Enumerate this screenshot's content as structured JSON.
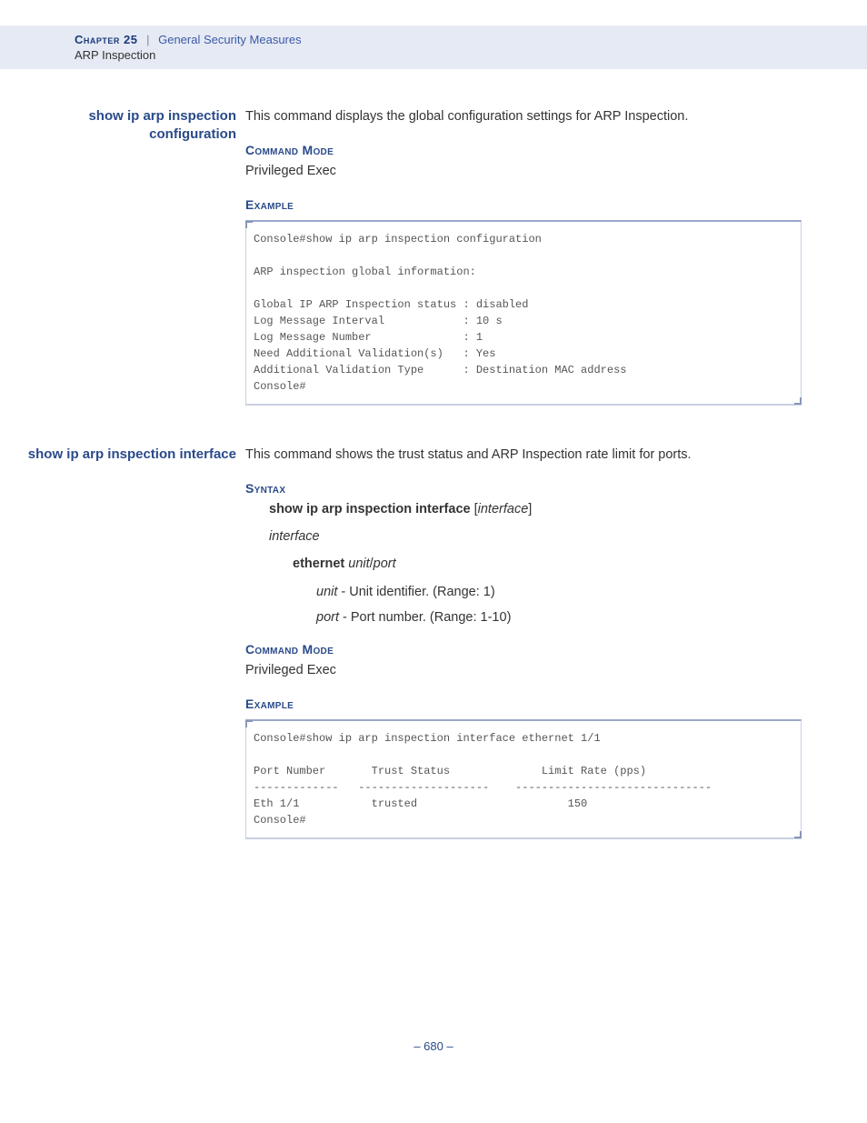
{
  "header": {
    "chapter_label": "Chapter 25",
    "separator": "|",
    "chapter_title": "General Security Measures",
    "subtitle": "ARP Inspection"
  },
  "sections": [
    {
      "margin_title": "show ip arp inspection configuration",
      "description": "This command displays the global configuration settings for ARP Inspection.",
      "command_mode_head": "Command Mode",
      "command_mode": "Privileged Exec",
      "example_head": "Example",
      "example": "Console#show ip arp inspection configuration\n\nARP inspection global information:\n\nGlobal IP ARP Inspection status : disabled\nLog Message Interval            : 10 s\nLog Message Number              : 1\nNeed Additional Validation(s)   : Yes\nAdditional Validation Type      : Destination MAC address\nConsole#"
    },
    {
      "margin_title": "show ip arp inspection interface",
      "description": "This command shows the trust status and ARP Inspection rate limit for ports.",
      "syntax_head": "Syntax",
      "syntax_cmd_bold": "show ip arp inspection interface",
      "syntax_cmd_param": "interface",
      "syntax_interface": "interface",
      "syntax_ethernet": "ethernet",
      "syntax_unit": "unit",
      "syntax_slash": "/",
      "syntax_port": "port",
      "syntax_unit_desc": " - Unit identifier. (Range: 1)",
      "syntax_port_desc": " - Port number. (Range: 1-10)",
      "command_mode_head": "Command Mode",
      "command_mode": "Privileged Exec",
      "example_head": "Example",
      "example": "Console#show ip arp inspection interface ethernet 1/1\n\nPort Number       Trust Status              Limit Rate (pps)\n-------------   --------------------    ------------------------------\nEth 1/1           trusted                       150\nConsole#"
    }
  ],
  "page_num": "– 680 –"
}
